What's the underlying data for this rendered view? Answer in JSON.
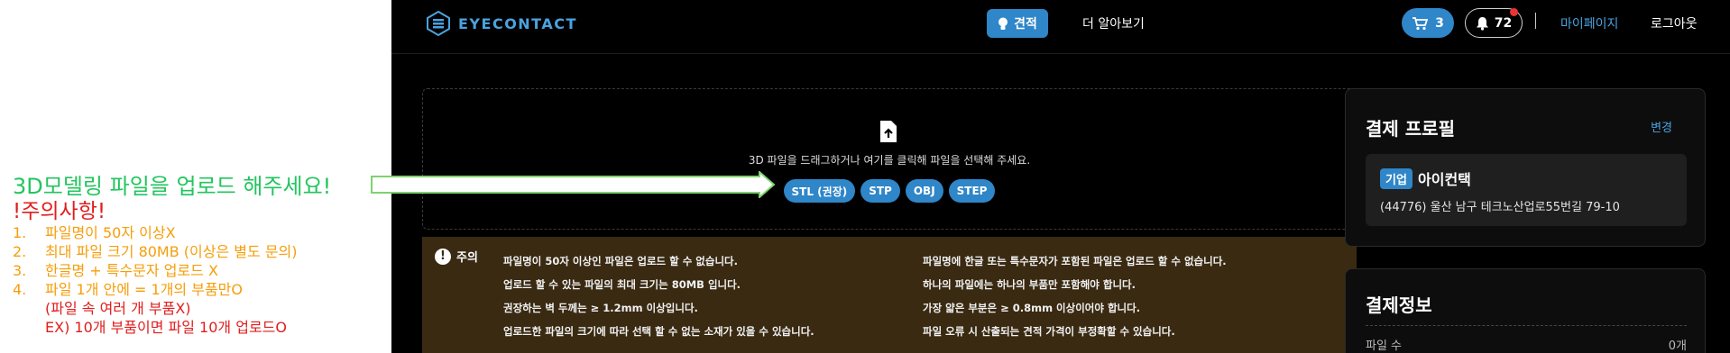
{
  "annotation": {
    "title": "3D모델링 파일을 업로드 해주세요!",
    "warning_title": "!주의사항!",
    "items": [
      {
        "num": "1.",
        "text": "파일명이 50자 이상X"
      },
      {
        "num": "2.",
        "text": "최대 파일 크기 80MB (이상은 별도 문의)"
      },
      {
        "num": "3.",
        "text": "한글명 + 특수문자 업로드 X"
      },
      {
        "num": "4.",
        "text": "파일 1개 안에 = 1개의 부품만O"
      }
    ],
    "sub1": "(파일 속 여러 개 부품X)",
    "sub2": "EX) 10개 부품이면 파일 10개 업로드O"
  },
  "header": {
    "logo_text": "EYECONTACT",
    "quote_label": "견적",
    "more_label": "더 알아보기",
    "cart_count": "3",
    "notification_count": "72",
    "mypage_label": "마이페이지",
    "logout_label": "로그아웃"
  },
  "upload": {
    "instruction": "3D 파일을 드래그하거나 여기를 클릭해 파일을 선택해 주세요.",
    "formats": [
      "STL (권장)",
      "STP",
      "OBJ",
      "STEP"
    ]
  },
  "notice": {
    "label": "주의",
    "left": [
      "파일명이 50자 이상인 파일은 업로드 할 수 없습니다.",
      "업로드 할 수 있는 파일의 최대 크기는 80MB 입니다.",
      "권장하는 벽 두께는 ≥ 1.2mm 이상입니다.",
      "업로드한 파일의 크기에 따라 선택 할 수 없는 소재가 있을 수 있습니다."
    ],
    "right": [
      "파일명에 한글 또는 특수문자가 포함된 파일은 업로드 할 수 없습니다.",
      "하나의 파일에는 하나의 부품만 포함해야 합니다.",
      "가장 얇은 부분은 ≥ 0.8mm 이상이어야 합니다.",
      "파일 오류 시 산출되는 견적 가격이 부정확할 수 있습니다."
    ]
  },
  "profile": {
    "title": "결제 프로필",
    "change_label": "변경",
    "badge": "기업",
    "company": "아이컨택",
    "address": "(44776) 울산 남구 테크노산업로55번길 79-10"
  },
  "payment": {
    "title": "결제정보",
    "row_label": "파일 수",
    "row_value": "0개"
  },
  "colors": {
    "accent": "#2f86c8",
    "annotation_green": "#22c55e",
    "annotation_red": "#e11d1d",
    "annotation_orange": "#f59e0b",
    "notice_bg": "#3a2a12"
  }
}
